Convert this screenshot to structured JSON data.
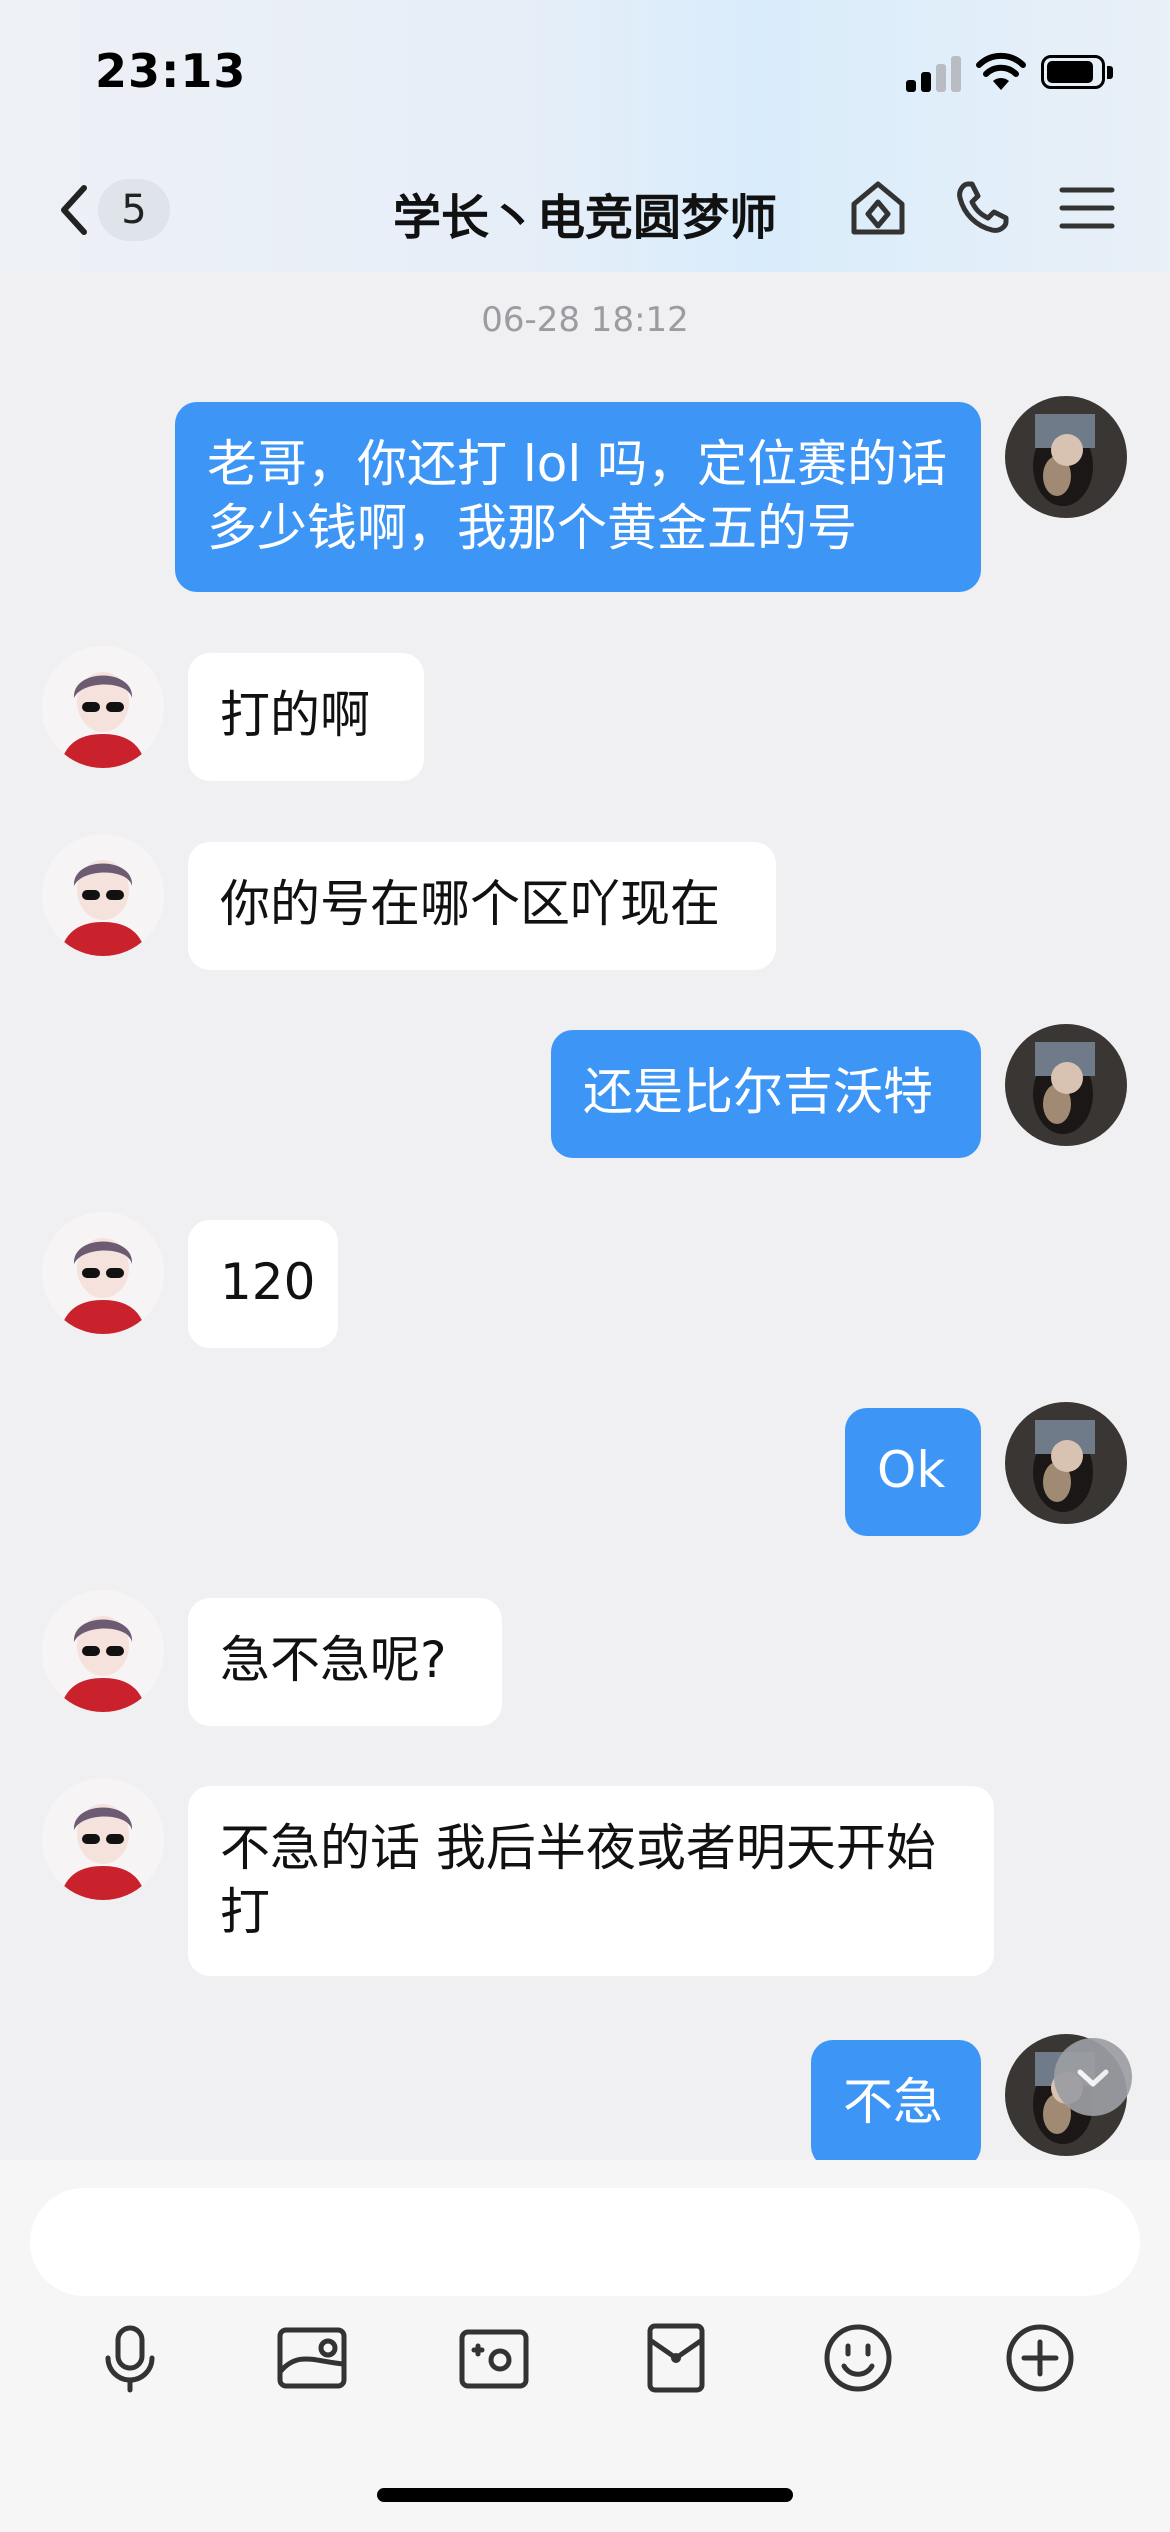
{
  "status": {
    "time": "23:13"
  },
  "nav": {
    "back_badge": "5",
    "title": "学长丶电竞圆梦师"
  },
  "chat": {
    "timestamp": "06-28 18:12",
    "messages": [
      {
        "side": "out",
        "text": "老哥，你还打 lol 吗，定位赛的话\n多少钱啊，我那个黄金五的号"
      },
      {
        "side": "in",
        "text": "打的啊"
      },
      {
        "side": "in",
        "text": "你的号在哪个区吖现在"
      },
      {
        "side": "out",
        "text": "还是比尔吉沃特"
      },
      {
        "side": "in",
        "text": "120"
      },
      {
        "side": "out",
        "text": "Ok"
      },
      {
        "side": "in",
        "text": "急不急呢?"
      },
      {
        "side": "in",
        "text": "不急的话 我后半夜或者明天开始\n打"
      },
      {
        "side": "out",
        "text": "不急"
      }
    ]
  },
  "input": {
    "placeholder": ""
  },
  "toolbar": {
    "icons": [
      "microphone-icon",
      "image-icon",
      "camera-icon",
      "red-envelope-icon",
      "emoji-icon",
      "plus-icon"
    ]
  },
  "colors": {
    "outgoing_bubble": "#3d95f6",
    "incoming_bubble": "#ffffff",
    "background": "#f0f0f2"
  }
}
